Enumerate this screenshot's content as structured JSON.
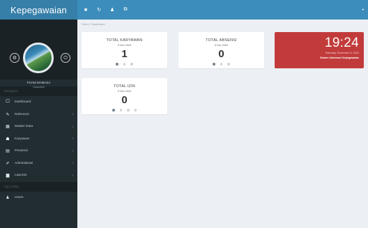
{
  "sidebar": {
    "brand": "Kepegawaian",
    "user": {
      "name": "FOAM MAMASA",
      "role": "Sysadmin"
    },
    "left_icon": "settings-icon",
    "right_icon": "power-icon",
    "menu_headers": {
      "navigation": "Navigation",
      "app_config": "App Config"
    },
    "items": [
      {
        "label": "Dashboard",
        "icon": "monitor-icon",
        "glyph": "🖵",
        "has_children": false
      },
      {
        "label": "Referensi",
        "icon": "wrench-icon",
        "glyph": "✎",
        "has_children": true
      },
      {
        "label": "Master Data",
        "icon": "grid-icon",
        "glyph": "▦",
        "has_children": true
      },
      {
        "label": "Karyawan",
        "icon": "users-icon",
        "glyph": "☗",
        "has_children": true
      },
      {
        "label": "Presensi",
        "icon": "list-icon",
        "glyph": "▤",
        "has_children": true
      },
      {
        "label": "Administrasi",
        "icon": "edit-icon",
        "glyph": "✐",
        "has_children": true
      },
      {
        "label": "Laporan",
        "icon": "document-icon",
        "glyph": "▆",
        "has_children": true
      }
    ],
    "config_items": [
      {
        "label": "Users",
        "icon": "user-icon",
        "glyph": "♟",
        "has_children": false
      }
    ]
  },
  "topbar": {
    "icons": [
      {
        "name": "menu-toggle-icon",
        "glyph": "■"
      },
      {
        "name": "refresh-icon",
        "glyph": "↻"
      },
      {
        "name": "user-icon",
        "glyph": "♟"
      },
      {
        "name": "external-link-icon",
        "glyph": "⧉"
      }
    ],
    "right_icon": {
      "name": "settings-icon",
      "glyph": "•"
    }
  },
  "breadcrumb": "Home  /  Dashboard",
  "cards": [
    {
      "title": "TOTAL KARYAWAN",
      "date": "5 Dec 2020",
      "value": "1",
      "dots": 3,
      "active_dot": 0
    },
    {
      "title": "TOTAL ABSENSI",
      "date": "5 Dec 2020",
      "value": "0",
      "dots": 3,
      "active_dot": 0
    },
    {
      "title": "TOTAL IZIN",
      "date": "5 Dec 2020",
      "value": "0",
      "dots": 4,
      "active_dot": 0
    }
  ],
  "clock": {
    "time": "19:24",
    "date": "Saturday, December 5, 2020",
    "info": "Sistem Informasi Kepegawaian"
  },
  "colors": {
    "sidebar_bg": "#222d32",
    "brand_bg": "#367fa9",
    "topbar_bg": "#3c8dbc",
    "clock_bg": "#c23b3b",
    "content_bg": "#ecf0f5"
  }
}
